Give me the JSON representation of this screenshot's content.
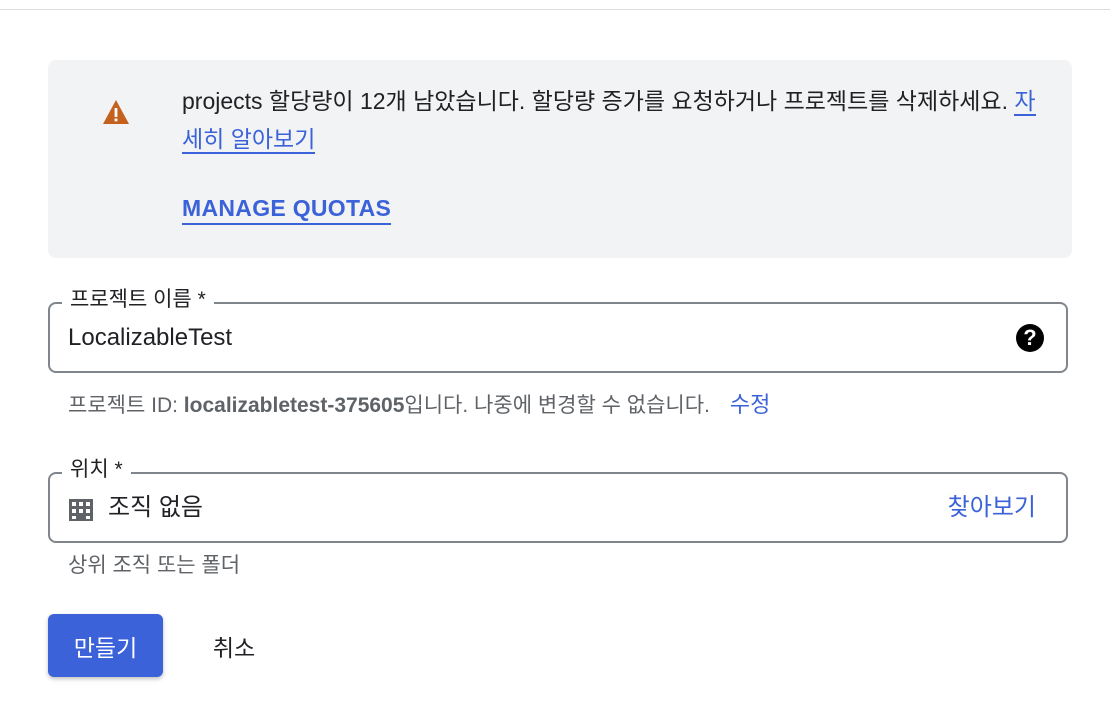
{
  "notice": {
    "message": "projects 할당량이 12개 남았습니다. 할당량 증가를 요청하거나 프로젝트를 삭제하세요. ",
    "learn_more": "자세히 알아보기",
    "manage_quotas": "MANAGE QUOTAS",
    "warning_color": "#c5611f"
  },
  "project_name": {
    "label": "프로젝트 이름 *",
    "value": "LocalizableTest",
    "help_icon": "help-circle-icon"
  },
  "project_id": {
    "prefix": "프로젝트 ID: ",
    "id": "localizabletest-375605",
    "suffix": "입니다. 나중에 변경할 수 없습니다.",
    "edit": "수정"
  },
  "location": {
    "label": "위치 *",
    "value": "조직 없음",
    "browse": "찾아보기",
    "helper": "상위 조직 또는 폴더",
    "icon": "building-icon"
  },
  "actions": {
    "create": "만들기",
    "cancel": "취소"
  },
  "colors": {
    "accent": "#3b62d8",
    "panel": "#f1f3f4"
  }
}
